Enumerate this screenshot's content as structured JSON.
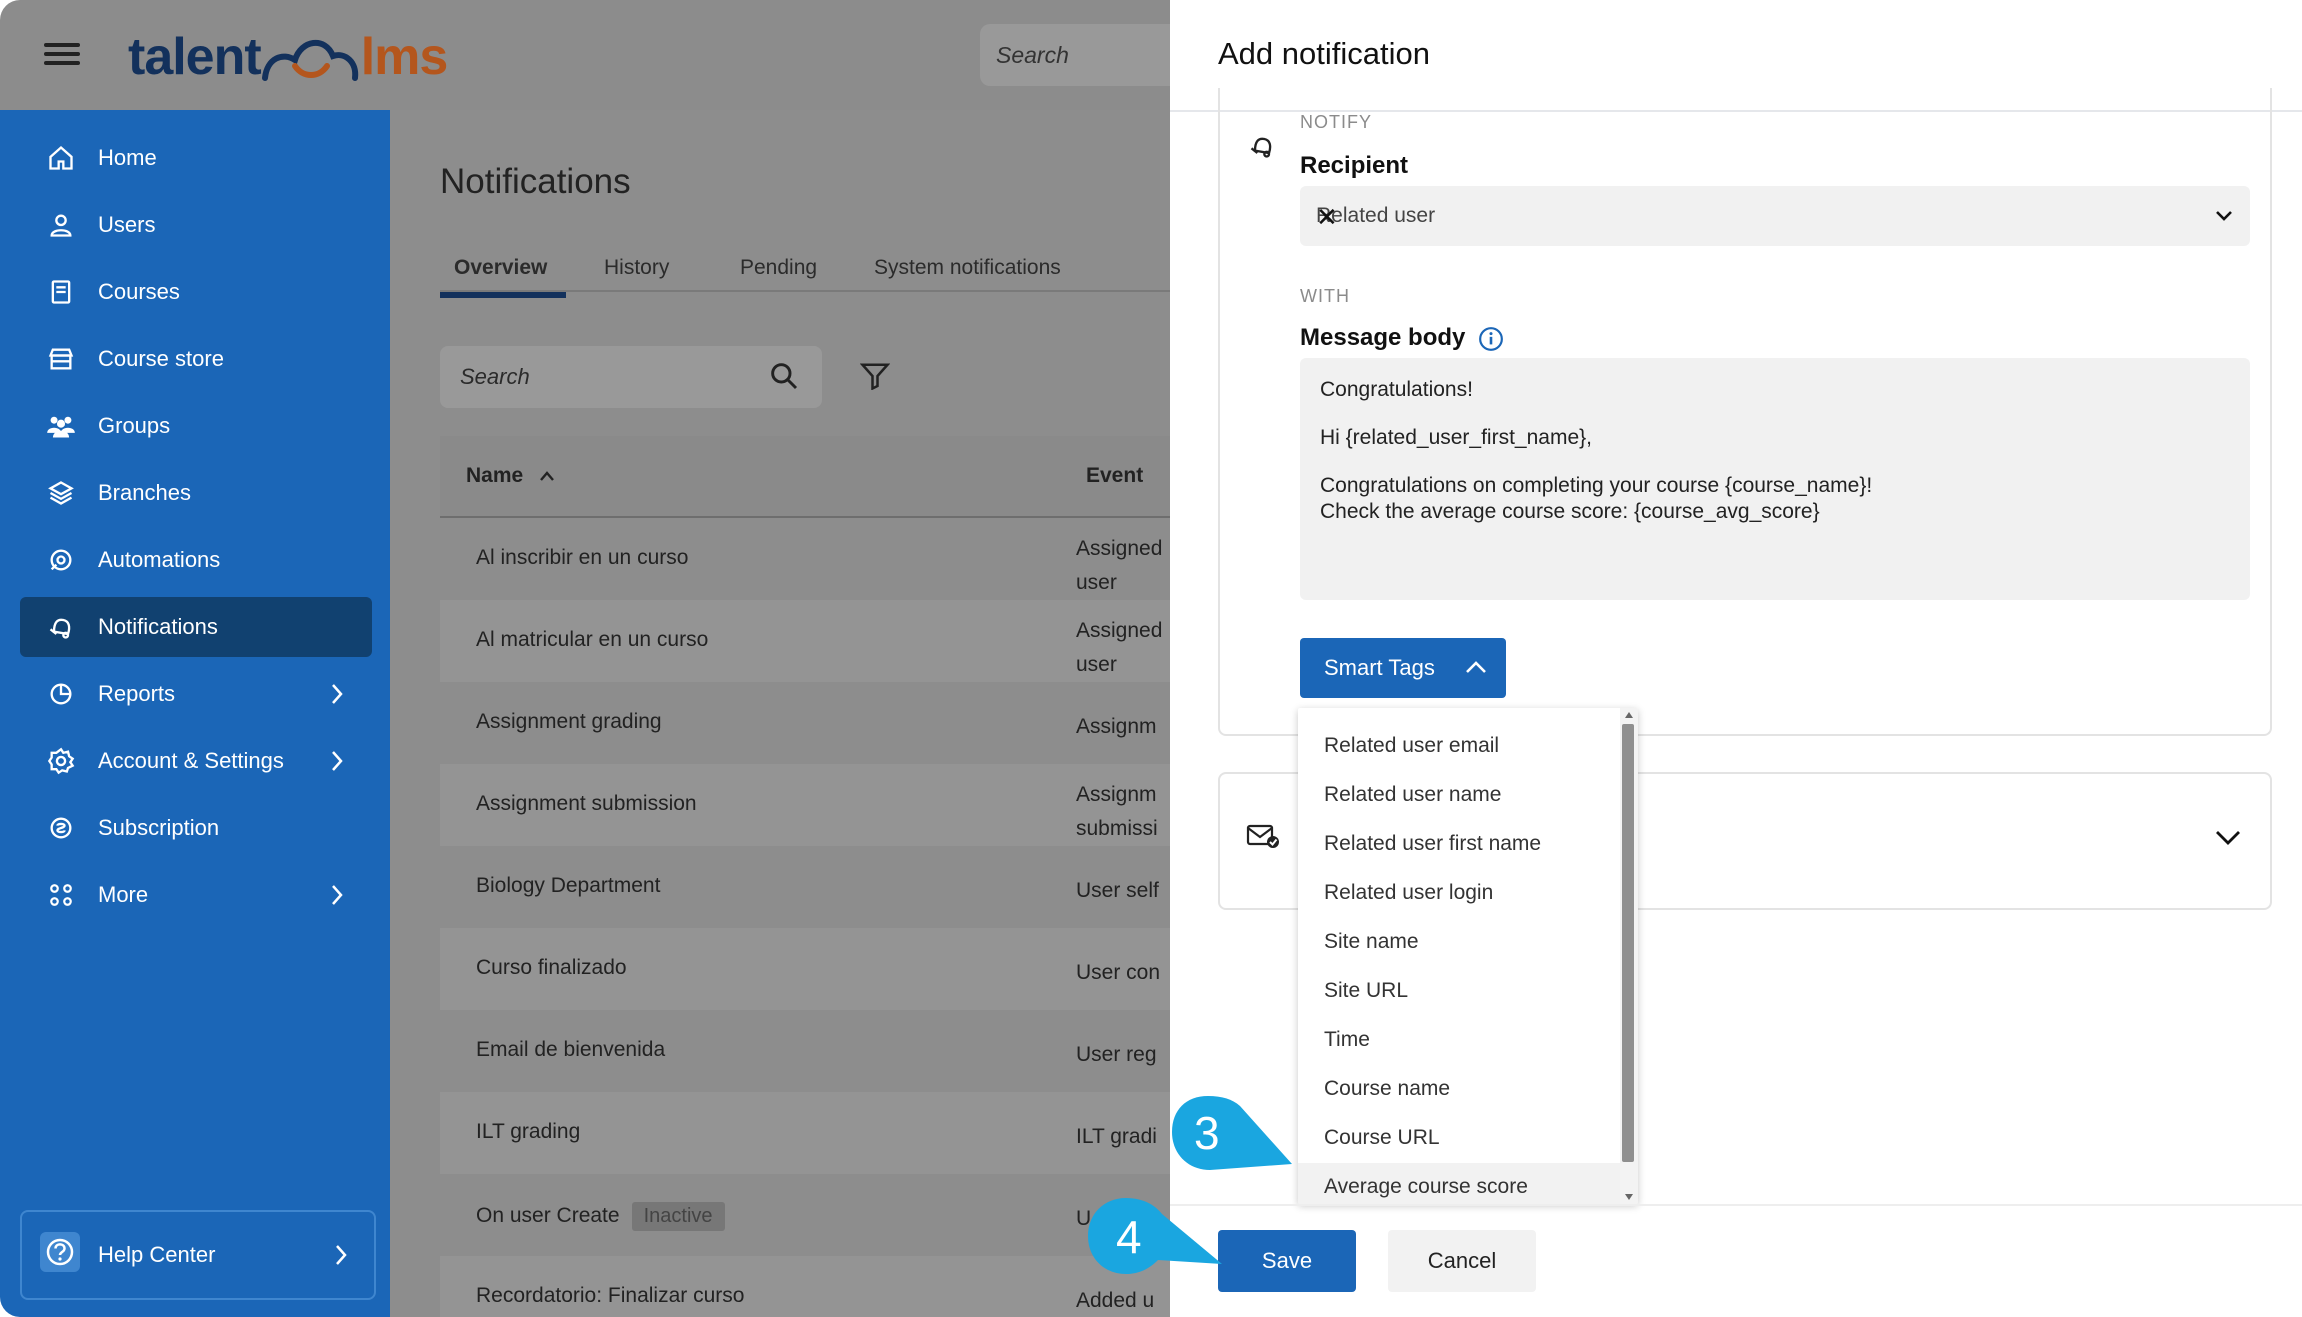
{
  "app": {
    "logo_left": "talent",
    "logo_right": "lms",
    "search_placeholder": "Search"
  },
  "sidebar": {
    "items": [
      {
        "label": "Home",
        "icon": "home-icon"
      },
      {
        "label": "Users",
        "icon": "user-icon"
      },
      {
        "label": "Courses",
        "icon": "book-icon"
      },
      {
        "label": "Course store",
        "icon": "store-icon"
      },
      {
        "label": "Groups",
        "icon": "groups-icon"
      },
      {
        "label": "Branches",
        "icon": "layers-icon"
      },
      {
        "label": "Automations",
        "icon": "automation-icon"
      },
      {
        "label": "Notifications",
        "icon": "bell-icon",
        "active": true
      },
      {
        "label": "Reports",
        "icon": "pie-chart-icon",
        "chevron": true
      },
      {
        "label": "Account & Settings",
        "icon": "gear-icon",
        "chevron": true
      },
      {
        "label": "Subscription",
        "icon": "subscription-icon"
      },
      {
        "label": "More",
        "icon": "grid-icon",
        "chevron": true
      }
    ],
    "help_label": "Help Center"
  },
  "main": {
    "title": "Notifications",
    "tabs": [
      "Overview",
      "History",
      "Pending",
      "System notifications"
    ],
    "search_placeholder": "Search",
    "columns": {
      "name": "Name",
      "event": "Event"
    },
    "rows": [
      {
        "name": "Al inscribir en un curso",
        "event": [
          "Assigned",
          "user"
        ]
      },
      {
        "name": "Al matricular en un curso",
        "event": [
          "Assigned",
          "user"
        ]
      },
      {
        "name": "Assignment grading",
        "event": [
          "Assignm"
        ]
      },
      {
        "name": "Assignment submission",
        "event": [
          "Assignm",
          "submissi"
        ]
      },
      {
        "name": "Biology Department",
        "event": [
          "User self"
        ]
      },
      {
        "name": "Curso finalizado",
        "event": [
          "User con"
        ]
      },
      {
        "name": "Email de bienvenida",
        "event": [
          "User reg"
        ]
      },
      {
        "name": "ILT grading",
        "event": [
          "ILT gradi"
        ]
      },
      {
        "name": "On user Create",
        "badge": "Inactive",
        "event": [
          "U"
        ]
      },
      {
        "name": "Recordatorio: Finalizar curso",
        "event": [
          "Added u"
        ]
      }
    ]
  },
  "panel": {
    "title": "Add notification",
    "notify_label": "NOTIFY",
    "recipient_label": "Recipient",
    "recipient_value": "Related user",
    "clear_symbol": "✕",
    "with_label": "WITH",
    "message_label": "Message body",
    "message_lines": [
      "Congratulations!",
      "Hi {related_user_first_name},",
      "Congratulations on completing your course {course_name}!",
      "Check the average course score: {course_avg_score}"
    ],
    "smart_tags_label": "Smart Tags",
    "smart_tags": [
      "Related user email",
      "Related user name",
      "Related user first name",
      "Related user login",
      "Site name",
      "Site URL",
      "Time",
      "Course name",
      "Course URL",
      "Average course score"
    ],
    "save_label": "Save",
    "cancel_label": "Cancel"
  },
  "callouts": {
    "step3": "3",
    "step4": "4"
  },
  "colors": {
    "brand_blue": "#1b66b7",
    "active_nav": "#114170",
    "callout": "#1aa6e0",
    "overlay": "#8d8d8d"
  }
}
